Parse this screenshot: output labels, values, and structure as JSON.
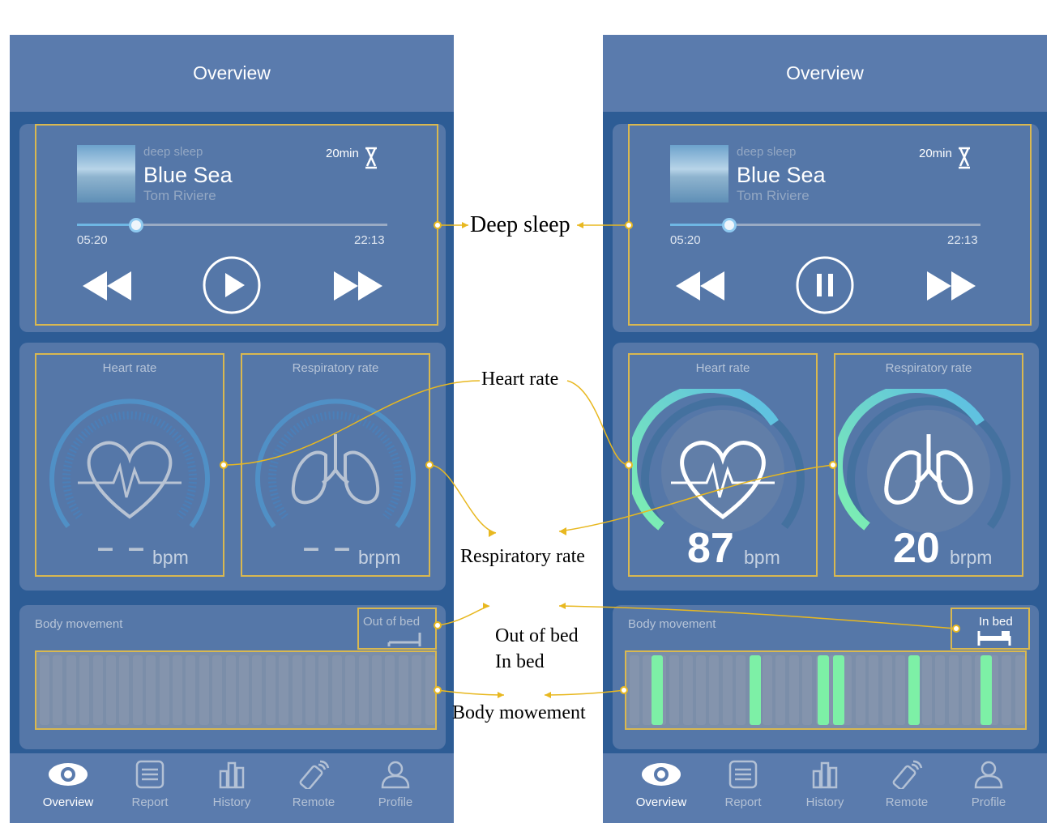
{
  "header": {
    "title": "Overview"
  },
  "screens": {
    "left": {
      "music": {
        "category": "deep sleep",
        "title": "Blue Sea",
        "artist": "Tom Riviere",
        "timer": "20min",
        "elapsed": "05:20",
        "total": "22:13",
        "progress": 0.19,
        "state": "paused",
        "play_icon": "play-icon"
      },
      "heart": {
        "label": "Heart rate",
        "value": "– –",
        "unit": "bpm",
        "fill": 0
      },
      "resp": {
        "label": "Respiratory rate",
        "value": "– –",
        "unit": "brpm",
        "fill": 0
      },
      "movement": {
        "label": "Body movement",
        "bed_status": "Out of bed",
        "bars": []
      }
    },
    "right": {
      "music": {
        "category": "deep sleep",
        "title": "Blue Sea",
        "artist": "Tom Riviere",
        "timer": "20min",
        "elapsed": "05:20",
        "total": "22:13",
        "progress": 0.19,
        "state": "playing",
        "play_icon": "pause-icon"
      },
      "heart": {
        "label": "Heart rate",
        "value": "87",
        "unit": "bpm",
        "fill": 0.87
      },
      "resp": {
        "label": "Respiratory rate",
        "value": "20",
        "unit": "brpm",
        "fill": 0.87
      },
      "movement": {
        "label": "Body movement",
        "bed_status": "In bed",
        "bars": [
          0.05,
          0.31,
          0.49,
          0.53,
          0.73,
          0.92
        ]
      }
    }
  },
  "nav": {
    "items": [
      {
        "label": "Overview",
        "icon": "eye-icon",
        "active": true
      },
      {
        "label": "Report",
        "icon": "report-icon",
        "active": false
      },
      {
        "label": "History",
        "icon": "bar-chart-icon",
        "active": false
      },
      {
        "label": "Remote",
        "icon": "remote-icon",
        "active": false
      },
      {
        "label": "Profile",
        "icon": "profile-icon",
        "active": false
      }
    ]
  },
  "annotations": {
    "deep_sleep": "Deep sleep",
    "heart_rate": "Heart rate",
    "respiratory_rate": "Respiratory rate",
    "out_of_bed": "Out of bed",
    "in_bed": "In bed",
    "body_movement": "Body mowement"
  },
  "colors": {
    "background": "#2d5c95",
    "panel": "#5577a8",
    "header": "#5a7bad",
    "frame": "#d9b850",
    "bar": "#7df0a6",
    "gauge": "#5fc9e8"
  }
}
